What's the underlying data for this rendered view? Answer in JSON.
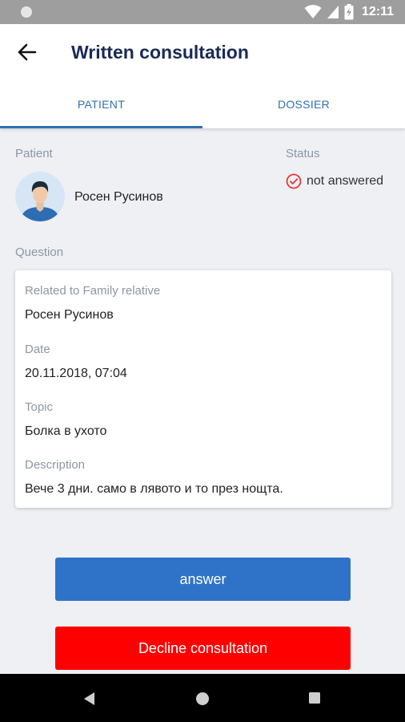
{
  "status_bar": {
    "time": "12:11",
    "icons": [
      "wifi-icon",
      "signal-icon",
      "battery-charging-icon"
    ]
  },
  "app_bar": {
    "back_icon": "arrow-left-icon",
    "title": "Written consultation"
  },
  "tabs": [
    {
      "label": "PATIENT",
      "active": true
    },
    {
      "label": "DOSSIER",
      "active": false
    }
  ],
  "patient_section": {
    "label": "Patient",
    "name": "Росен Русинов"
  },
  "status_section": {
    "label": "Status",
    "value": "not answered",
    "icon": "check-circle-icon",
    "icon_color": "#e53935"
  },
  "question_section": {
    "label": "Question",
    "related_label": "Related to Family relative",
    "related_value": "Росен Русинов",
    "date_label": "Date",
    "date_value": "20.11.2018, 07:04",
    "topic_label": "Topic",
    "topic_value": "Болка в ухото",
    "description_label": "Description",
    "description_value": "Вече 3 дни. само в лявото и то през нощта."
  },
  "actions": {
    "answer_label": "answer",
    "decline_label": "Decline consultation",
    "answer_color": "#2f73c9",
    "decline_color": "#ff0000"
  },
  "nav_bar": {
    "icons": [
      "back-triangle-icon",
      "home-circle-icon",
      "recents-square-icon"
    ]
  }
}
